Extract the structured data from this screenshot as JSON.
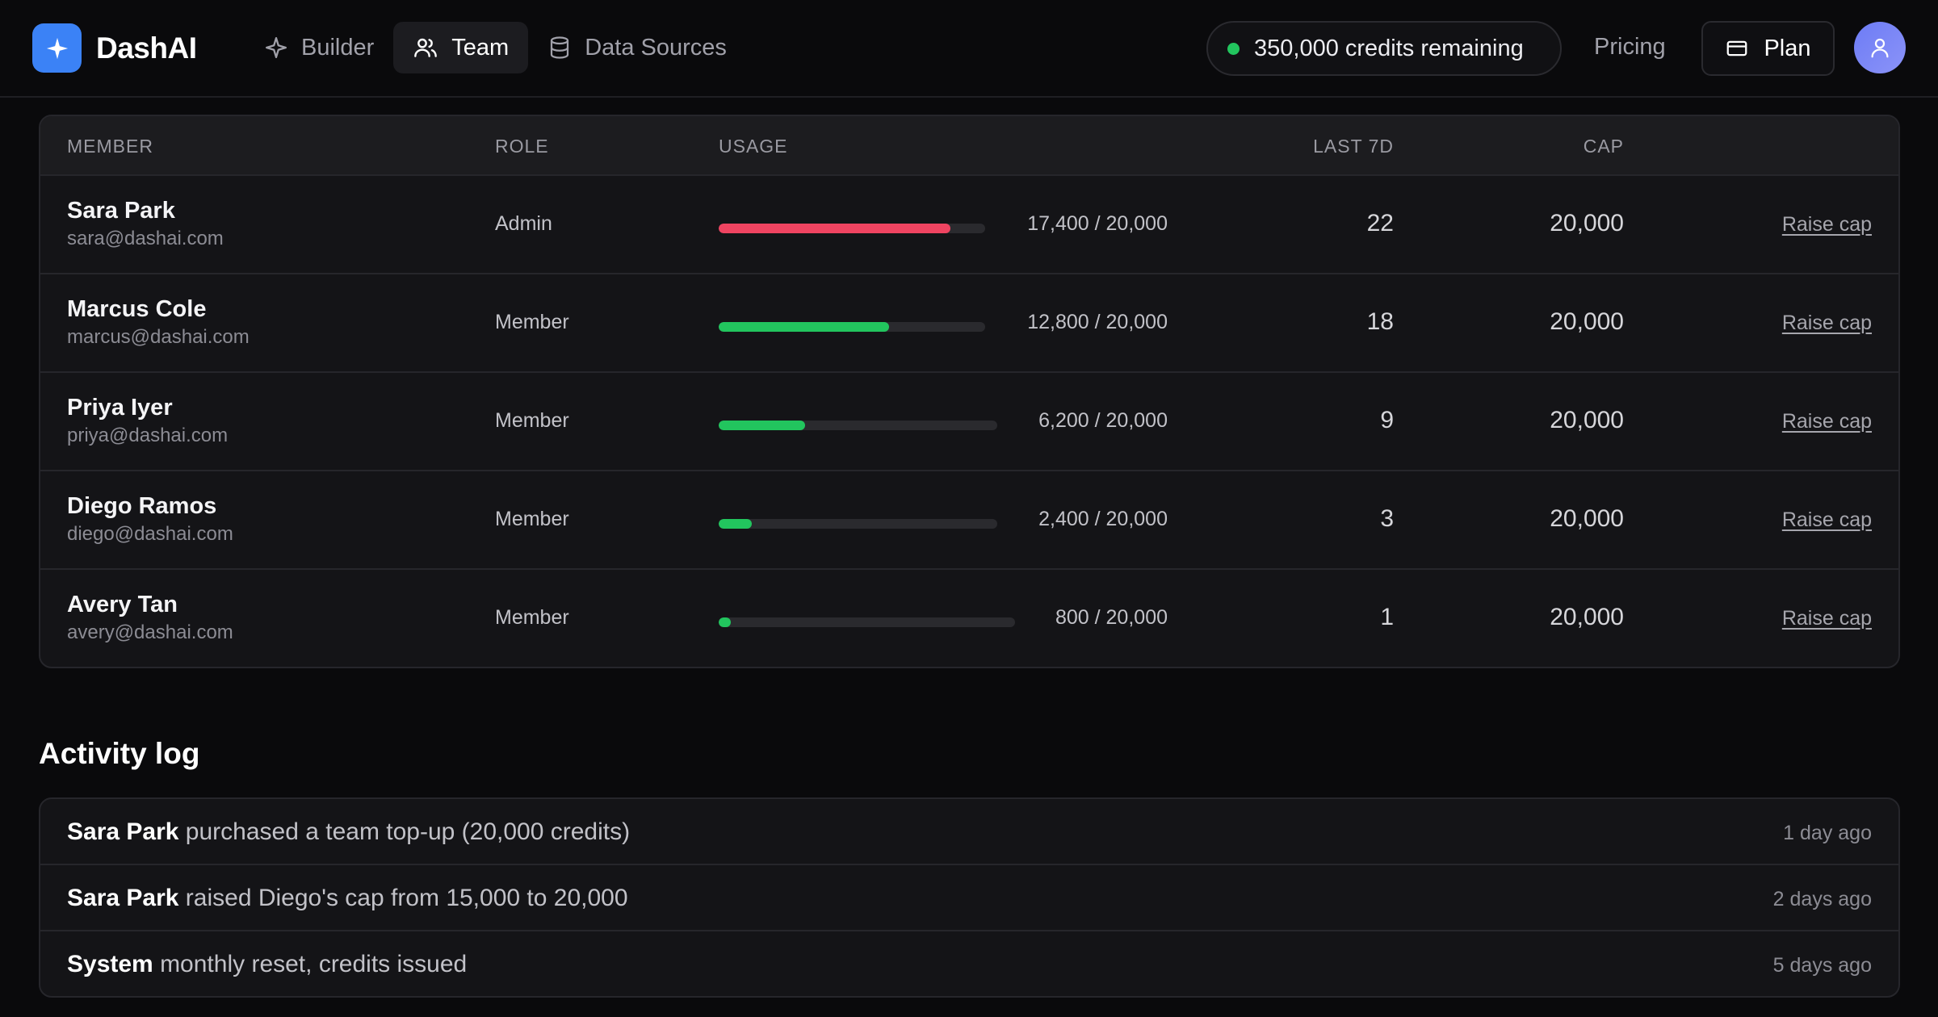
{
  "brand": {
    "name": "DashAI"
  },
  "nav": [
    {
      "label": "Builder",
      "icon": "sparkle-icon",
      "active": false
    },
    {
      "label": "Team",
      "icon": "users-icon",
      "active": true
    },
    {
      "label": "Data Sources",
      "icon": "database-icon",
      "active": false
    }
  ],
  "header": {
    "credits_label": "350,000 credits remaining",
    "credits_status_color": "#22c55e",
    "pricing_label": "Pricing",
    "plan_label": "Plan"
  },
  "table": {
    "columns": [
      "MEMBER",
      "ROLE",
      "USAGE",
      "LAST 7D",
      "CAP"
    ],
    "rows": [
      {
        "name": "Sara Park",
        "email": "sara@dashai.com",
        "role": "Admin",
        "usage_text": "17,400 / 20,000",
        "usage_fraction": 0.87,
        "usage_color": "#ef4461",
        "last7": "22",
        "cap": "20,000",
        "action": "Raise cap"
      },
      {
        "name": "Marcus Cole",
        "email": "marcus@dashai.com",
        "role": "Member",
        "usage_text": "12,800 / 20,000",
        "usage_fraction": 0.64,
        "usage_color": "#22c55e",
        "last7": "18",
        "cap": "20,000",
        "action": "Raise cap"
      },
      {
        "name": "Priya Iyer",
        "email": "priya@dashai.com",
        "role": "Member",
        "usage_text": "6,200 / 20,000",
        "usage_fraction": 0.31,
        "usage_color": "#22c55e",
        "last7": "9",
        "cap": "20,000",
        "action": "Raise cap"
      },
      {
        "name": "Diego Ramos",
        "email": "diego@dashai.com",
        "role": "Member",
        "usage_text": "2,400 / 20,000",
        "usage_fraction": 0.12,
        "usage_color": "#22c55e",
        "last7": "3",
        "cap": "20,000",
        "action": "Raise cap"
      },
      {
        "name": "Avery Tan",
        "email": "avery@dashai.com",
        "role": "Member",
        "usage_text": "800 / 20,000",
        "usage_fraction": 0.04,
        "usage_color": "#22c55e",
        "last7": "1",
        "cap": "20,000",
        "action": "Raise cap"
      }
    ]
  },
  "activity": {
    "title": "Activity log",
    "entries": [
      {
        "actor": "Sara Park",
        "text": " purchased a team top-up (20,000 credits)",
        "time": "1 day ago"
      },
      {
        "actor": "Sara Park",
        "text": " raised Diego's cap from 15,000 to 20,000",
        "time": "2 days ago"
      },
      {
        "actor": "System",
        "text": " monthly reset, credits issued",
        "time": "5 days ago"
      }
    ]
  }
}
